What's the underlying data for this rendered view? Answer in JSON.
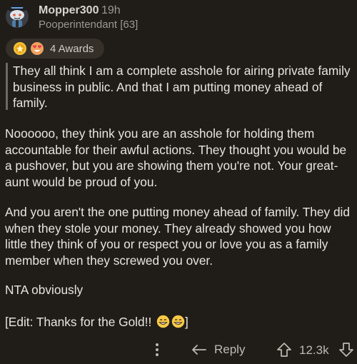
{
  "comment": {
    "username": "Mopper300",
    "time": "19h",
    "flair": "Pooperintendant [63]",
    "awards_label": "4 Awards",
    "quote": "They all think I am a complete asshole for airing private family business in public. And that I am putting money ahead of family.",
    "paragraphs": [
      "Noooooo, they think you are an asshole for holding them accountable for their awful actions. They thought you would be a pushover, but you are showing them you're not. Your great-aunt would be proud of you.",
      "And you aren't the one putting money ahead of family. They did when they stole your money. They already showed you how little they think of you or respect you or love you as a family member when they screwed you over.",
      "NTA obviously"
    ],
    "edit_text": "[Edit: Thanks for the Gold!! ",
    "edit_close": "]"
  },
  "actions": {
    "reply_label": "Reply",
    "score": "12.3k"
  },
  "icons": {
    "avatar": "snoo-avatar-icon",
    "awards": [
      "gold-award-icon",
      "heart-eyes-award-icon"
    ],
    "emoji": "grinning-face-emoji",
    "more": "more-options-icon",
    "reply": "reply-arrow-icon",
    "upvote": "upvote-arrow-icon",
    "downvote": "downvote-arrow-icon"
  },
  "colors": {
    "background": "#201c17",
    "text": "#e8e5e1",
    "muted": "#9b9791",
    "pill": "#35302a",
    "gold": "#f3c535"
  }
}
